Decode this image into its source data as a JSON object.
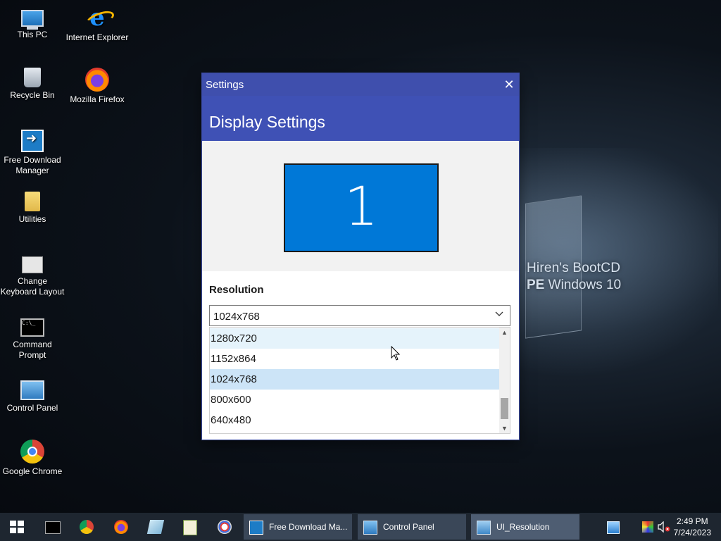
{
  "desktop": {
    "icons": [
      {
        "label": "This PC",
        "icon": "this-pc-icon"
      },
      {
        "label": "Internet Explorer",
        "icon": "internet-explorer-icon"
      },
      {
        "label": "Recycle Bin",
        "icon": "recycle-bin-icon"
      },
      {
        "label": "Mozilla Firefox",
        "icon": "firefox-icon"
      },
      {
        "label": "Free Download Manager",
        "icon": "free-download-manager-icon"
      },
      {
        "label": "Utilities",
        "icon": "folder-icon"
      },
      {
        "label": "Change Keyboard Layout",
        "icon": "keyboard-layout-icon"
      },
      {
        "label": "Command Prompt",
        "icon": "command-prompt-icon"
      },
      {
        "label": "Control Panel",
        "icon": "control-panel-icon"
      },
      {
        "label": "Google Chrome",
        "icon": "chrome-icon"
      }
    ],
    "wallpaper_brand_line1": "Hiren's BootCD",
    "wallpaper_brand_line2_bold": "PE",
    "wallpaper_brand_line2_rest": " Windows 10"
  },
  "window": {
    "title": "Settings",
    "close_glyph": "✕",
    "header_title": "Display Settings",
    "monitor_number": "1",
    "resolution_label": "Resolution",
    "selected_resolution": "1024x768",
    "options": [
      {
        "label": "1280x720",
        "state": "hover"
      },
      {
        "label": "1152x864",
        "state": "normal"
      },
      {
        "label": "1024x768",
        "state": "selected"
      },
      {
        "label": "800x600",
        "state": "normal"
      },
      {
        "label": "640x480",
        "state": "normal"
      }
    ],
    "accent_color": "#3f51b5",
    "monitor_color": "#0078d7"
  },
  "taskbar": {
    "pinned": [
      "command-prompt-icon",
      "chrome-icon",
      "firefox-icon",
      "notepad-icon",
      "editor-icon",
      "paint-icon"
    ],
    "tasks": [
      {
        "label": "Free Download Ma...",
        "icon": "free-download-manager-icon"
      },
      {
        "label": "Control Panel",
        "icon": "control-panel-icon"
      },
      {
        "label": "UI_Resolution",
        "icon": "app-window-icon"
      }
    ],
    "time": "2:49 PM",
    "date": "7/24/2023"
  }
}
